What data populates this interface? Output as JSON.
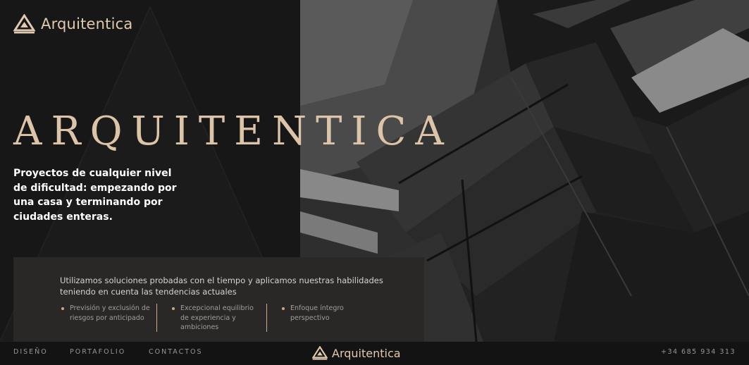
{
  "brand": {
    "name": "Arquitentica"
  },
  "hero": {
    "title": "ARQUITENTICA",
    "subtitle": "Proyectos de cualquier nivel de dificultad: empezando por una casa y terminando por ciudades enteras."
  },
  "info": {
    "heading": "Utilizamos soluciones probadas con el tiempo y aplicamos nuestras habilidades teniendo en cuenta las tendencias actuales",
    "features": [
      {
        "text": "Previsión y exclusión de riesgos por anticipado"
      },
      {
        "text": "Excepcional equilibrio de experiencia y ambiciones"
      },
      {
        "text": "Enfoque íntegro perspectivo"
      }
    ]
  },
  "footer": {
    "nav": [
      {
        "label": "DISEÑO"
      },
      {
        "label": "PORTAFOLIO"
      },
      {
        "label": "CONTACTOS"
      }
    ],
    "brand": "Arquitentica",
    "phone": "+34 685 934 313"
  },
  "colors": {
    "accent": "#c9ab86",
    "background": "#181717",
    "panel": "#2a2827"
  },
  "icons": {
    "logo": "a-triangle-logo-icon",
    "bullet": "dot-icon"
  }
}
